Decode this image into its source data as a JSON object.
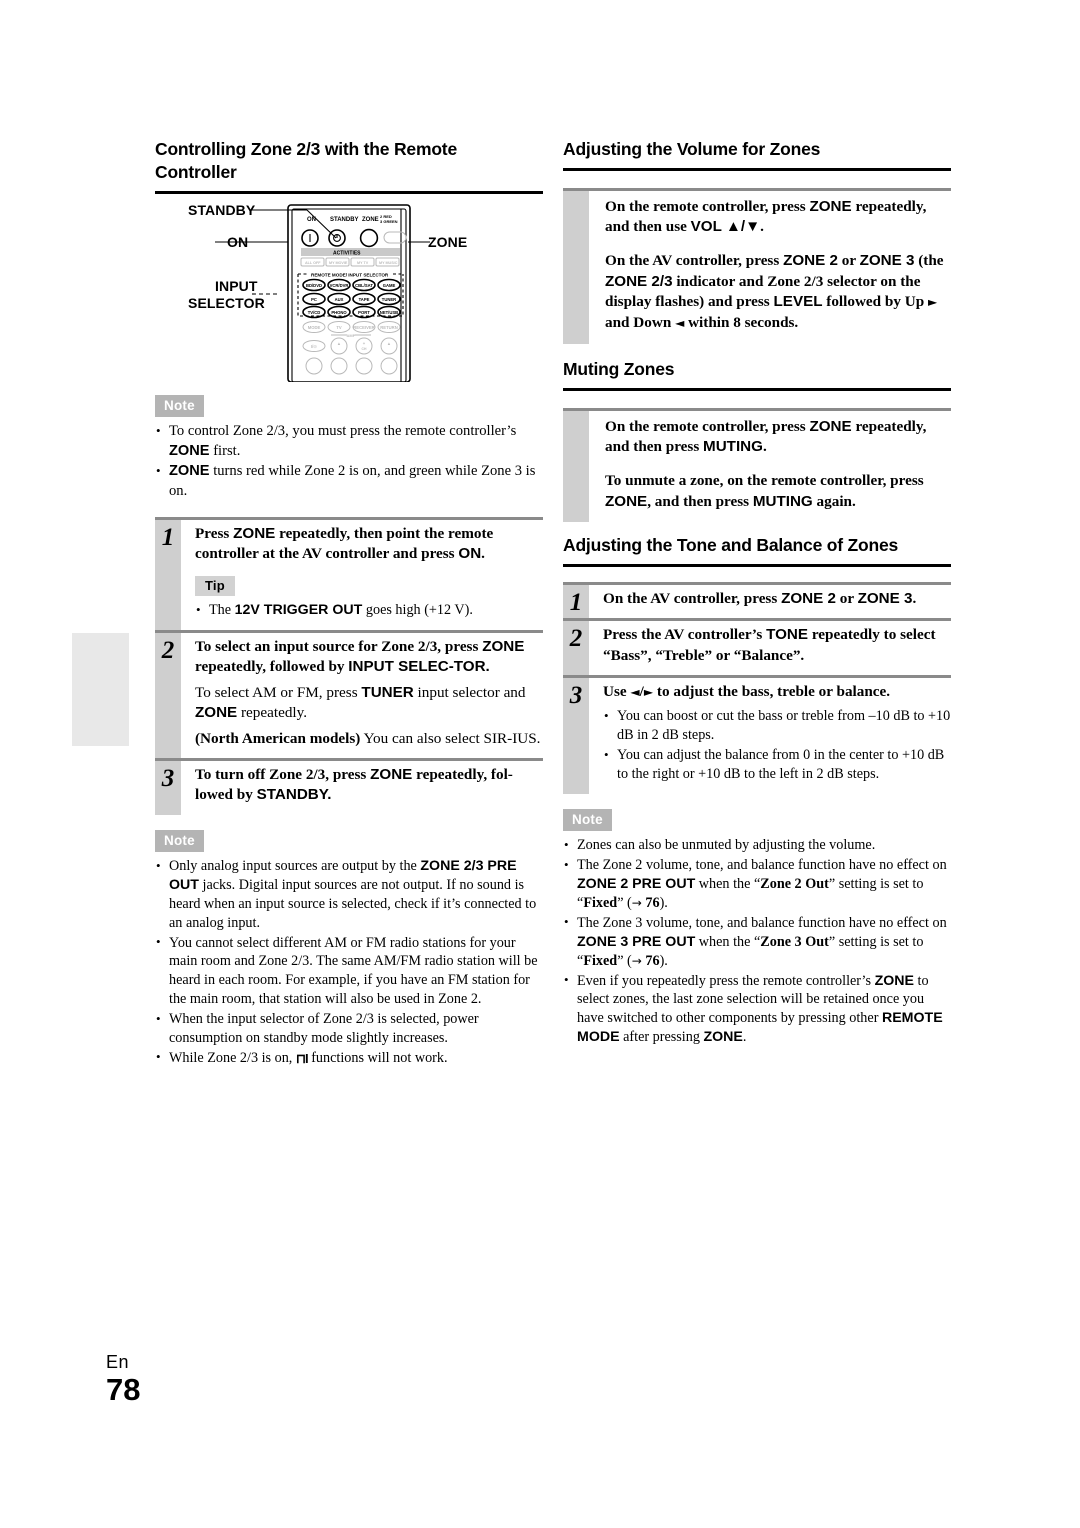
{
  "page": {
    "language_label": "En",
    "number": "78"
  },
  "left_column": {
    "heading": "Controlling Zone 2/3 with the Remote Controller",
    "figure": {
      "callouts": {
        "standby": "STANDBY",
        "on": "ON",
        "input": "INPUT",
        "selector": "SELECTOR",
        "zone": "ZONE"
      },
      "remote": {
        "top_labels": {
          "on": "ON",
          "standby": "STANDBY",
          "zone": "ZONE",
          "zone_legend_line1": "2 RED",
          "zone_legend_line2": "3 GREEN"
        },
        "activities_label": "ACTIVITIES",
        "activities_buttons": [
          "ALL OFF",
          "MY MOVIE",
          "MY TV",
          "MY MUSIC"
        ],
        "selector_group_label": "REMOTE MODE/ INPUT SELECTOR",
        "selector_buttons": [
          "BD/DVD",
          "VCR/DVR",
          "CBL/SAT",
          "GAME",
          "PC",
          "AUX",
          "TAPE",
          "TUNER",
          "TV/CD",
          "PHONO",
          "PORT",
          "NET/USB"
        ],
        "faded_row": [
          "MODE",
          "TV",
          "RECEIVER",
          "RETURN"
        ],
        "amp_label": "AMP",
        "bottom_row": [
          "I/☉",
          "–",
          "+ CH",
          "–"
        ]
      }
    },
    "note1": {
      "badge": "Note",
      "bullets": [
        "To control Zone 2/3, you must press the remote controller’s ZONE first.",
        "ZONE turns red while Zone 2 is on, and green while Zone 3 is on."
      ]
    },
    "steps": [
      {
        "num": "1",
        "lead": "Press ZONE repeatedly, then point the remote controller at the AV controller and press ON.",
        "tip": {
          "badge": "Tip",
          "bullets": [
            "The 12V TRIGGER OUT goes high (+12 V)."
          ]
        }
      },
      {
        "num": "2",
        "lead": "To select an input source for Zone 2/3, press ZONE repeatedly, followed by INPUT SELEC-TOR.",
        "subs": [
          "To select AM or FM, press TUNER input selector and ZONE repeatedly.",
          "(North American models) You can also select SIRIUS."
        ]
      },
      {
        "num": "3",
        "lead": "To turn off Zone 2/3, press ZONE repeatedly, followed by STANDBY."
      }
    ],
    "note2": {
      "badge": "Note",
      "bullets": [
        "Only analog input sources are output by the ZONE 2/3 PRE OUT jacks. Digital input sources are not output. If no sound is heard when an input source is selected, check if it’s connected to an analog input.",
        "You cannot select different AM or FM radio stations for your main room and Zone 2/3. The same AM/FM radio station will be heard in each room. For example, if you have an FM station for the main room, that station will also be used in Zone 2.",
        "When the input selector of Zone 2/3 is selected, power consumption on standby mode slightly increases.",
        "While Zone 2/3 is on, RI functions will not work."
      ]
    }
  },
  "right_column": {
    "volume_section": {
      "heading": "Adjusting the Volume for Zones",
      "paragraphs": [
        "On the remote controller, press ZONE repeatedly, and then use VOL ▲/▼.",
        "On the AV controller, press ZONE 2 or ZONE 3 (the ZONE 2/3 indicator and Zone 2/3 selector on the display flashes) and press LEVEL followed by Up ► and Down ◄ within 8 seconds."
      ]
    },
    "muting_section": {
      "heading": "Muting Zones",
      "paragraphs": [
        "On the remote controller, press ZONE repeatedly, and then press MUTING.",
        "To unmute a zone, on the remote controller, press ZONE, and then press MUTING again."
      ]
    },
    "tone_section": {
      "heading": "Adjusting the Tone and Balance of Zones",
      "steps": [
        {
          "num": "1",
          "lead": "On the AV controller, press ZONE 2 or ZONE 3."
        },
        {
          "num": "2",
          "lead": "Press the AV controller’s TONE repeatedly to select “Bass”, “Treble” or “Balance”."
        },
        {
          "num": "3",
          "lead": "Use ◄/► to adjust the bass, treble or balance.",
          "bullets": [
            "You can boost or cut the bass or treble from –10 dB to +10 dB in 2 dB steps.",
            "You can adjust the balance from 0 in the center to +10 dB to the right or +10 dB to the left in 2 dB steps."
          ]
        }
      ]
    },
    "note": {
      "badge": "Note",
      "bullets": [
        "Zones can also be unmuted by adjusting the volume.",
        "The Zone 2 volume, tone, and balance function have no effect on ZONE 2 PRE OUT when the “Zone 2 Out” setting is set to “Fixed” (→ 76).",
        "The Zone 3 volume, tone, and balance function have no effect on ZONE 3 PRE OUT when the “Zone 3 Out” setting is set to “Fixed” (→ 76).",
        "Even if you repeatedly press the remote controller’s ZONE to select zones, the last zone selection will be retained once you have switched to other components by pressing other REMOTE MODE after pressing ZONE."
      ]
    }
  },
  "colors": {
    "rule": "#000000",
    "step_bar": "#cfcfcf",
    "badge_note": "#b4b4b4",
    "badge_tip": "#d2d2d2",
    "thumb_tab": "#e8e8e8"
  }
}
